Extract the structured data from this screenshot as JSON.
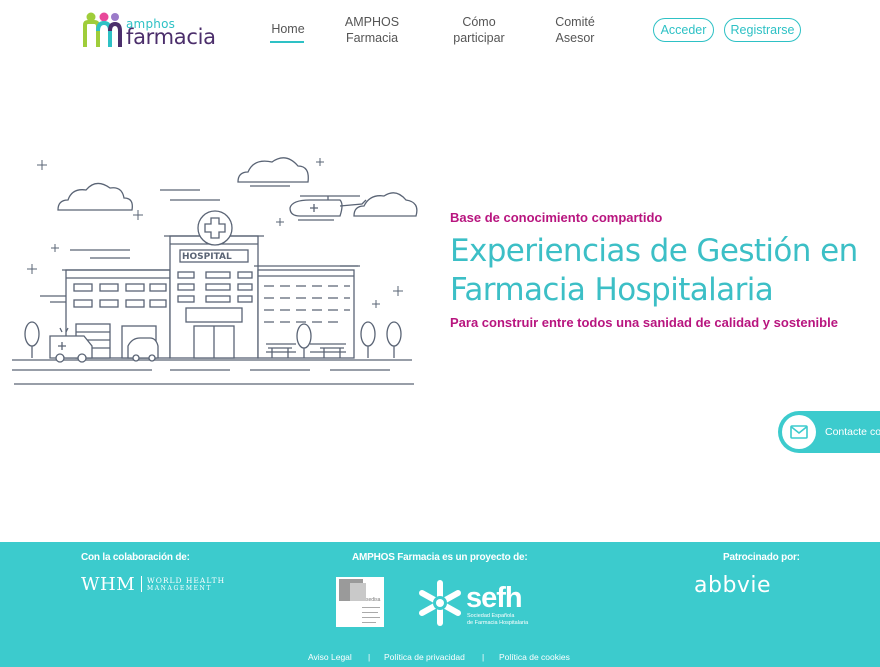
{
  "header": {
    "logo": {
      "small": "amphos",
      "big": "farmacia"
    },
    "nav": {
      "home": "Home",
      "amphos_line1": "AMPHOS",
      "amphos_line2": "Farmacia",
      "como_line1": "Cómo",
      "como_line2": "participar",
      "comite_line1": "Comité",
      "comite_line2": "Asesor"
    },
    "acceder": "Acceder",
    "registrarse": "Registrarse"
  },
  "hero": {
    "illustration_sign": "HOSPITAL",
    "kicker": "Base de conocimiento compartido",
    "title_line1": "Experiencias de Gestión en",
    "title_line2": "Farmacia Hospitalaria",
    "subtitle": "Para construir entre todos una sanidad de calidad y sostenible"
  },
  "contact": {
    "label": "Contacte co"
  },
  "footer": {
    "collab_heading": "Con la colaboración de:",
    "project_heading": "AMPHOS Farmacia es un proyecto de:",
    "sponsor_heading": "Patrocinado por:",
    "whm": {
      "abbr": "WHM",
      "line1": "WORLD HEALTH",
      "line2": "MANAGEMENT"
    },
    "sedisa": {
      "name": "sedisa"
    },
    "sefh": {
      "word": "sefh",
      "sub1": "Sociedad Española",
      "sub2": "de Farmacia Hospitalaria"
    },
    "abbvie": "abbvie",
    "links": {
      "aviso": "Aviso Legal",
      "privacidad": "Política de privacidad",
      "cookies": "Política de cookies",
      "separator": "|"
    }
  },
  "colors": {
    "teal": "#3ccbcd",
    "magenta": "#b8157f",
    "title": "#3cbfc6"
  }
}
